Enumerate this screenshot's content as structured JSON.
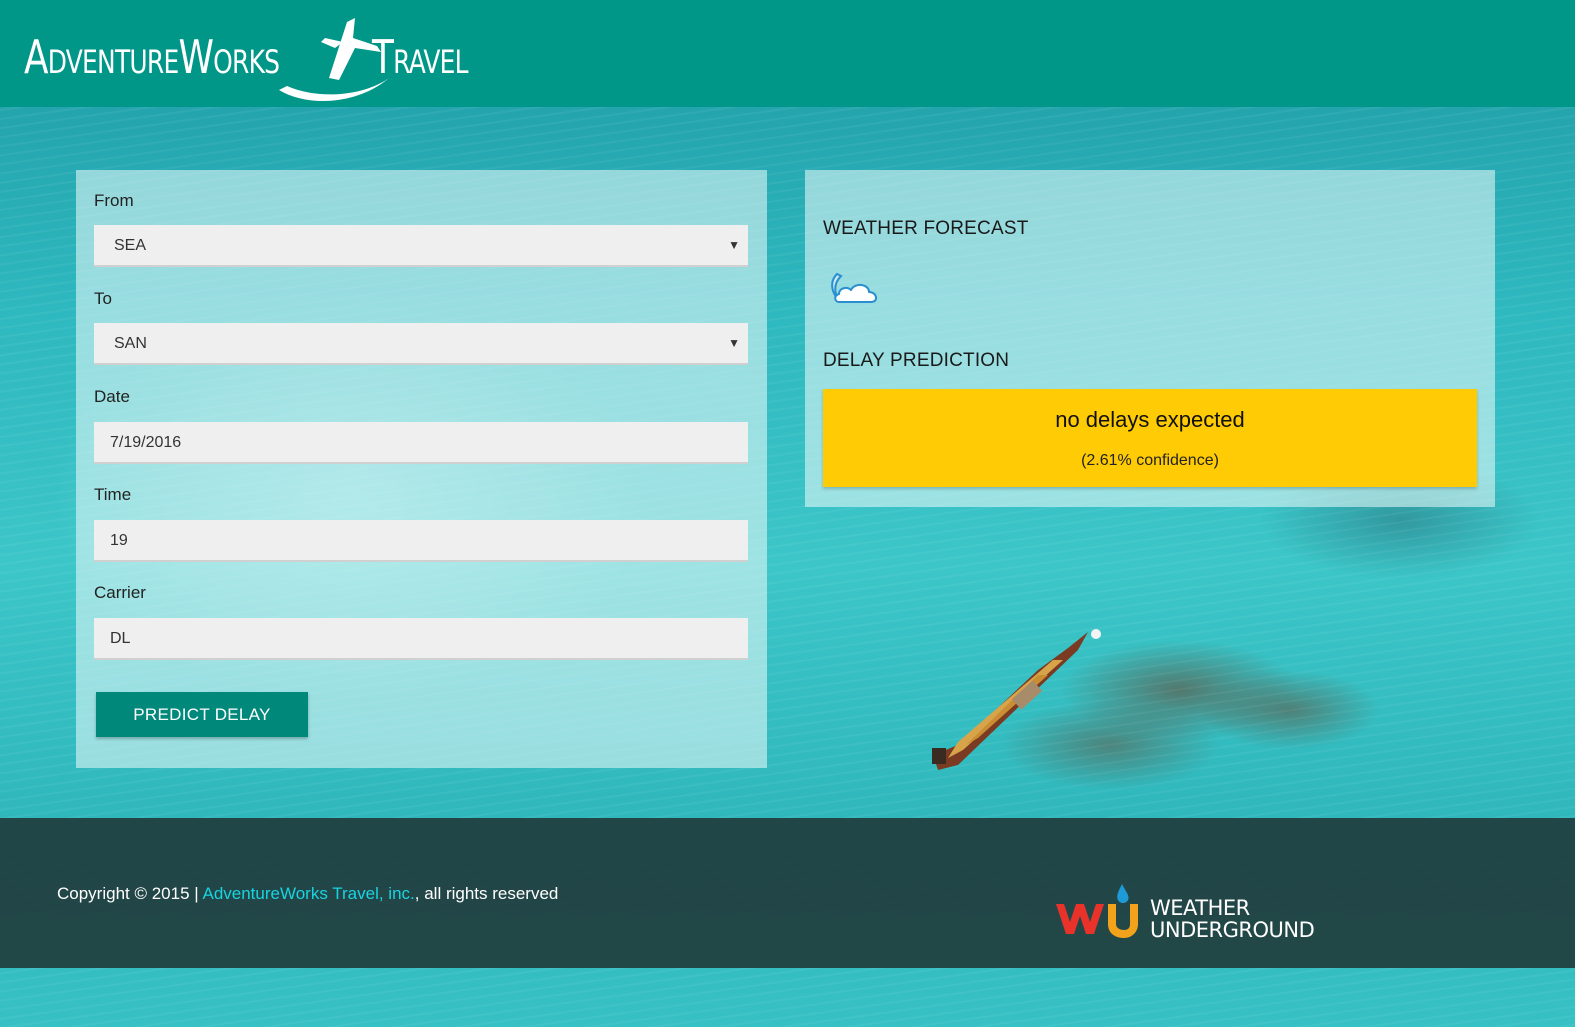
{
  "header": {
    "brand_left": "AdventureWorks",
    "brand_right": "Travel",
    "brand_color": "#009688",
    "logo_icon": "plane-swoosh-icon"
  },
  "form": {
    "from_label": "From",
    "from_value": "SEA",
    "to_label": "To",
    "to_value": "SAN",
    "date_label": "Date",
    "date_value": "7/19/2016",
    "time_label": "Time",
    "time_value": "19",
    "carrier_label": "Carrier",
    "carrier_value": "DL",
    "submit_label": "PREDICT DELAY",
    "button_color": "#00897b"
  },
  "results": {
    "weather_title": "WEATHER FORECAST",
    "weather_icon": "moon-cloud-icon",
    "delay_title": "DELAY PREDICTION",
    "delay_text": "no delays expected",
    "confidence_text": "(2.61% confidence)",
    "delay_box_color": "#ffcb05"
  },
  "footer": {
    "copyright_prefix": "Copyright © 2015 |",
    "company_link": "AdventureWorks Travel, inc.",
    "copyright_suffix": ", all rights reserved",
    "link_color": "#19d3e0",
    "partner_line1": "WEATHER",
    "partner_line2": "UNDERGROUND",
    "partner_icon": "weather-underground-logo"
  }
}
